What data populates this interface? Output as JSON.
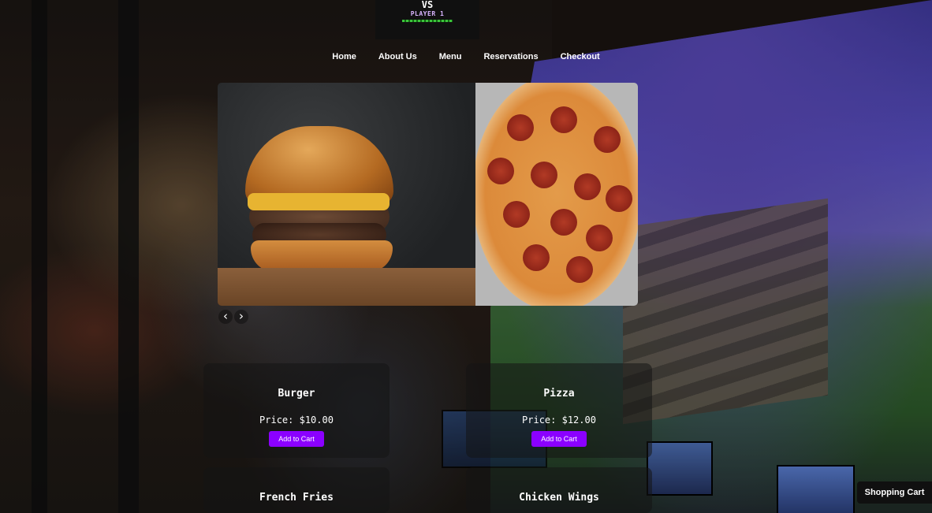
{
  "logo": {
    "top_text": "VS",
    "bottom_text": "PLAYER 1"
  },
  "nav": {
    "items": [
      "Home",
      "About Us",
      "Menu",
      "Reservations",
      "Checkout"
    ]
  },
  "carousel": {
    "prev_label": "‹",
    "next_label": "›"
  },
  "menu": {
    "items": [
      {
        "name": "Burger",
        "price": "Price: $10.00",
        "button": "Add to Cart"
      },
      {
        "name": "Pizza",
        "price": "Price: $12.00",
        "button": "Add to Cart"
      },
      {
        "name": "French Fries"
      },
      {
        "name": "Chicken Wings"
      }
    ]
  },
  "cart": {
    "label": "Shopping Cart"
  },
  "colors": {
    "accent": "#8b00ff",
    "logo_bg": "#101010"
  }
}
